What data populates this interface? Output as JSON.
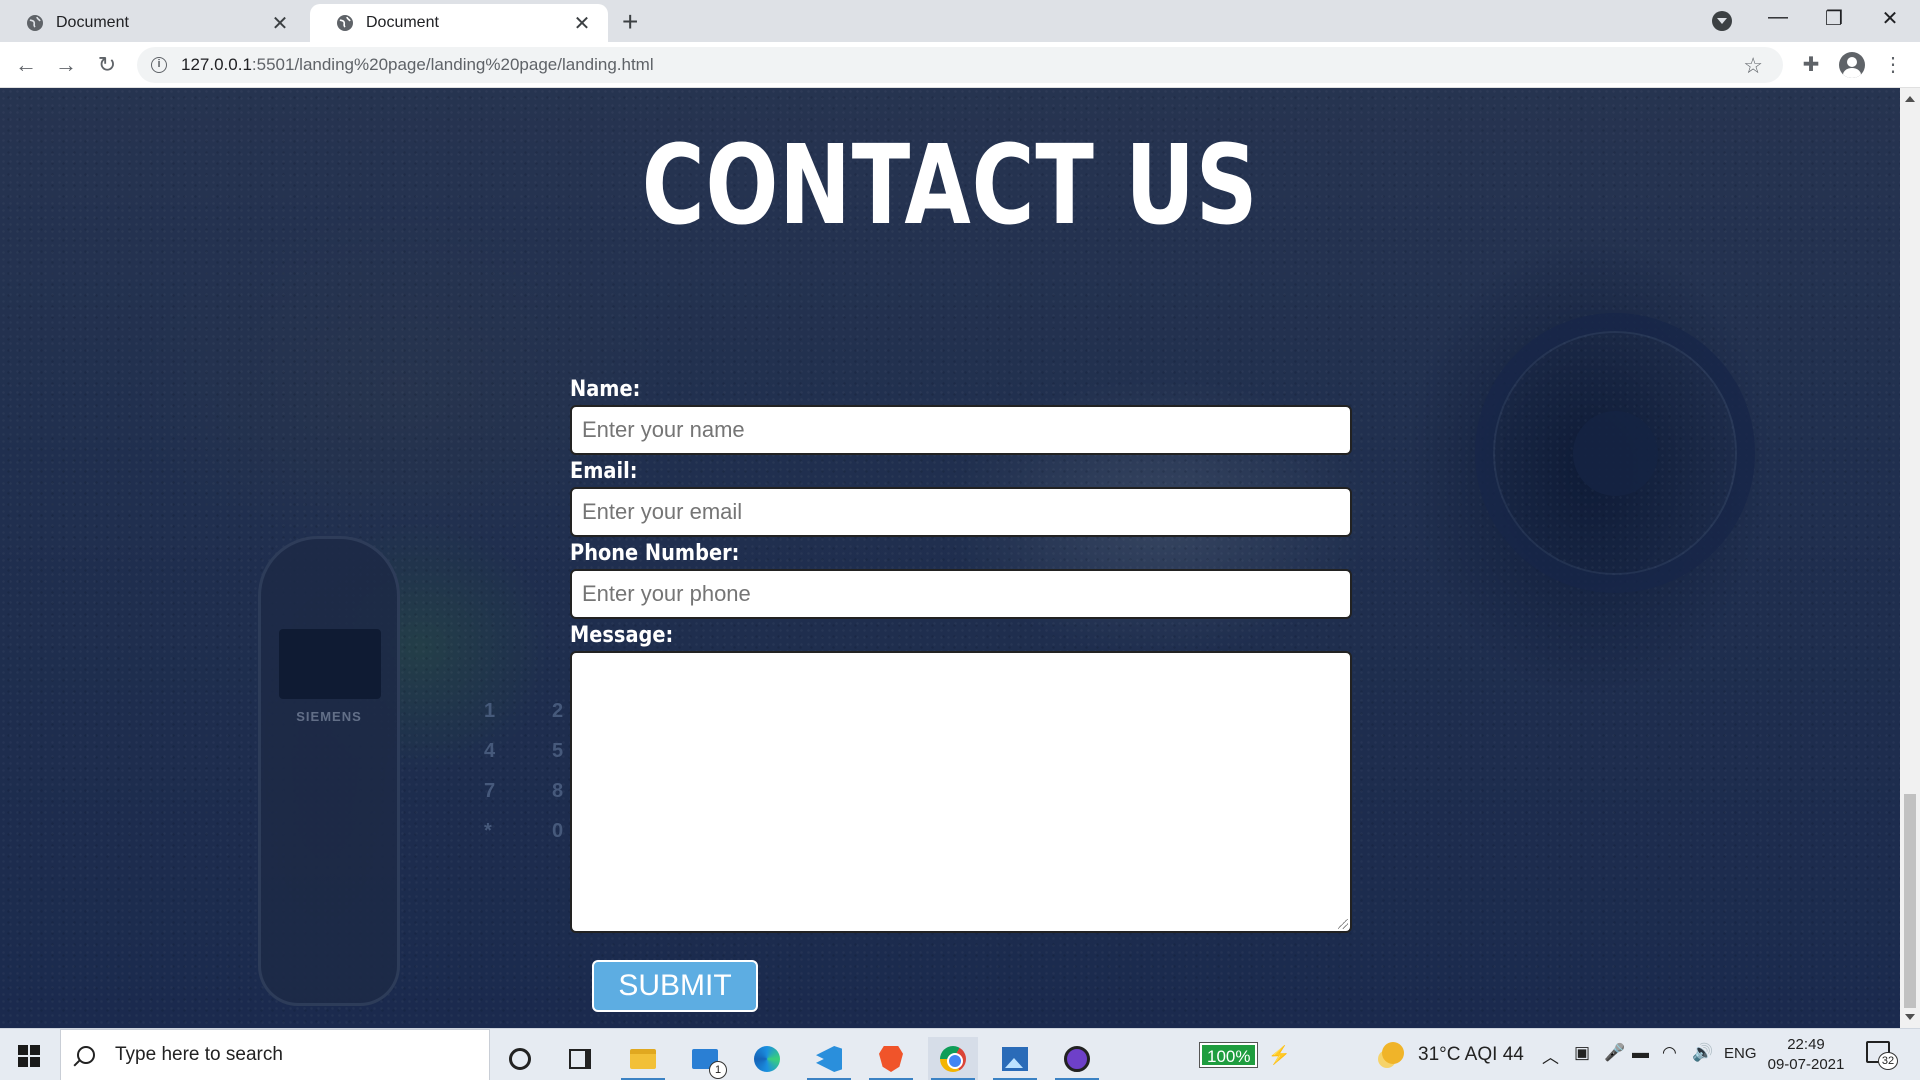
{
  "browser": {
    "tabs": [
      {
        "title": "Document",
        "active": false
      },
      {
        "title": "Document",
        "active": true
      }
    ],
    "url_host": "127.0.0.1",
    "url_rest": ":5501/landing%20page/landing%20page/landing.html"
  },
  "page": {
    "heading": "CONTACT US",
    "form": {
      "name_label": "Name:",
      "name_placeholder": "Enter your name",
      "email_label": "Email:",
      "email_placeholder": "Enter your email",
      "phone_label": "Phone Number:",
      "phone_placeholder": "Enter your phone",
      "message_label": "Message:",
      "submit_label": "SUBMIT"
    },
    "background_photo": {
      "handset_brand": "SIEMENS",
      "keypad_digits": [
        "1",
        "2",
        "4",
        "5",
        "7",
        "8",
        "*",
        "0"
      ]
    },
    "colors": {
      "submit": "#5dade2",
      "overlay": "#0f234b"
    }
  },
  "taskbar": {
    "search_placeholder": "Type here to search",
    "mail_badge": "1",
    "battery": "100%",
    "weather": "31°C  AQI 44",
    "language": "ENG",
    "time": "22:49",
    "date": "09-07-2021",
    "notification_count": "32"
  }
}
